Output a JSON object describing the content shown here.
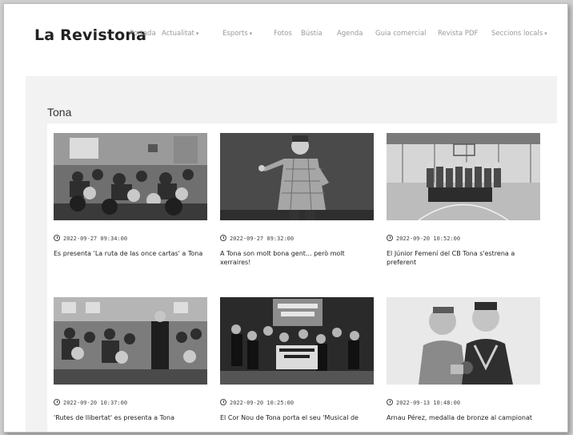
{
  "site": {
    "logo_prefix": "La Revis",
    "logo_suffix": "tona"
  },
  "nav": {
    "items": [
      {
        "label": "Portada"
      },
      {
        "label": "Actualitat",
        "dropdown": true
      },
      {
        "label": "Esports",
        "dropdown": true
      },
      {
        "label": "Fotos"
      },
      {
        "label": "Bústia"
      },
      {
        "label": "Agenda"
      },
      {
        "label": "Guia comercial"
      },
      {
        "label": "Revista PDF"
      },
      {
        "label": "Seccions locals",
        "dropdown": true
      }
    ],
    "caret": "▾"
  },
  "section": {
    "title": "Tona"
  },
  "articles": [
    {
      "date": "2022-09-27 09:34:00",
      "title": "Es presenta 'La ruta de las once cartas' a Tona",
      "image": "audience-room"
    },
    {
      "date": "2022-09-27 09:32:00",
      "title": "A Tona son molt bona gent... però molt xerraires!",
      "image": "speaker"
    },
    {
      "date": "2022-09-20 10:52:00",
      "title": "El Júnior Femení del CB Tona s'estrena a preferent",
      "image": "basketball-team"
    },
    {
      "date": "2022-09-20 10:37:00",
      "title": "'Rutes de llibertat' es presenta a Tona",
      "image": "audience-hall"
    },
    {
      "date": "2022-09-20 10:25:00",
      "title": "El Cor Nou de Tona porta el seu 'Musical de",
      "image": "musical-stage"
    },
    {
      "date": "2022-09-13 10:48:00",
      "title": "Arnau Pérez, medalla de bronze al campionat",
      "image": "medal-athletes"
    }
  ]
}
